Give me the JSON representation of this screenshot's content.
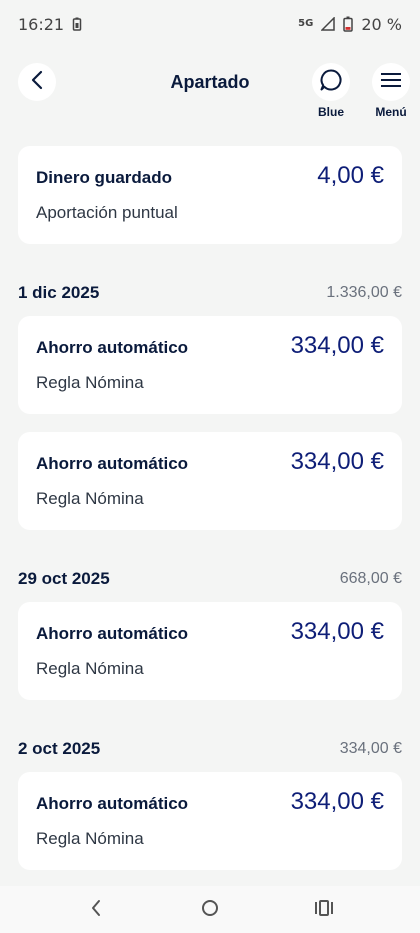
{
  "status_bar": {
    "time": "16:21",
    "network": "5G",
    "battery": "20 %",
    "icons": [
      "battery-saver-icon",
      "signal-icon",
      "battery-icon"
    ]
  },
  "header": {
    "title": "Apartado",
    "actions": [
      {
        "label": "Blue",
        "icon": "chat-bubble-icon"
      },
      {
        "label": "Menú",
        "icon": "hamburger-menu-icon"
      }
    ]
  },
  "summary": {
    "title": "Dinero guardado",
    "subtitle": "Aportación puntual",
    "amount": "4,00 €"
  },
  "groups": [
    {
      "date": "1 dic 2025",
      "total": "1.336,00 €",
      "items": [
        {
          "title": "Ahorro automático",
          "subtitle": "Regla Nómina",
          "amount": "334,00 €"
        },
        {
          "title": "Ahorro automático",
          "subtitle": "Regla Nómina",
          "amount": "334,00 €"
        }
      ]
    },
    {
      "date": "29 oct 2025",
      "total": "668,00 €",
      "items": [
        {
          "title": "Ahorro automático",
          "subtitle": "Regla Nómina",
          "amount": "334,00 €"
        }
      ]
    },
    {
      "date": "2 oct 2025",
      "total": "334,00 €",
      "items": [
        {
          "title": "Ahorro automático",
          "subtitle": "Regla Nómina",
          "amount": "334,00 €"
        }
      ]
    }
  ],
  "colors": {
    "background": "#F4F5F4",
    "card": "#FFFFFF",
    "primary_text": "#0A1A3C",
    "amount": "#0E1E77",
    "secondary_text": "#6A717D"
  }
}
